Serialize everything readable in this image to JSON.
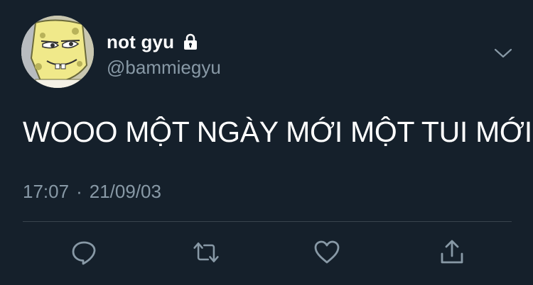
{
  "tweet": {
    "display_name": "not gyu",
    "handle": "@bammiegyu",
    "text": "WOOO MỘT NGÀY MỚI MỘT TUI MỚI",
    "time": "17:07",
    "separator": "·",
    "date": "21/09/03"
  },
  "icons": {
    "lock": "lock-icon",
    "chevron": "chevron-down-icon",
    "reply": "reply-icon",
    "retweet": "retweet-icon",
    "like": "heart-icon",
    "share": "share-icon"
  },
  "colors": {
    "background": "#15202b",
    "text_primary": "#ffffff",
    "text_secondary": "#8899a6",
    "divider": "#38444d"
  }
}
